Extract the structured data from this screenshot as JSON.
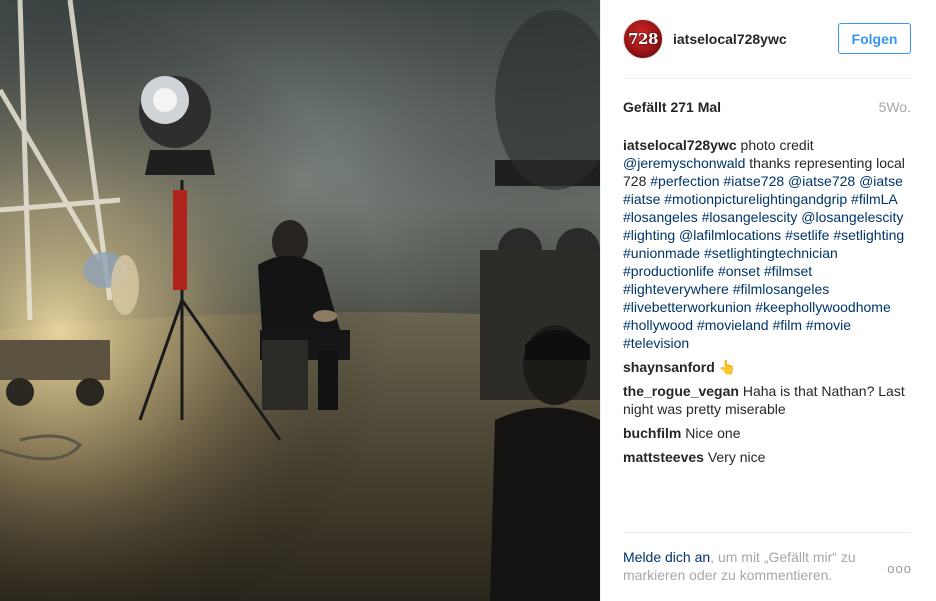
{
  "post": {
    "image_alt": "Film set at night with lighting equipment and a man sitting on a crate"
  },
  "header": {
    "avatar_text": "728",
    "username": "iatselocal728ywc",
    "follow_label": "Folgen"
  },
  "stats": {
    "likes_prefix": "Gefällt ",
    "likes_count": "271",
    "likes_suffix": " Mal",
    "age": "5Wo."
  },
  "caption": {
    "author": "iatselocal728ywc",
    "parts": [
      {
        "t": " photo credit "
      },
      {
        "t": "@jeremyschonwald",
        "link": true
      },
      {
        "t": " thanks representing local 728 "
      },
      {
        "t": "#perfection",
        "link": true
      },
      {
        "t": " "
      },
      {
        "t": "#iatse728",
        "link": true
      },
      {
        "t": " "
      },
      {
        "t": "@iatse728",
        "link": true
      },
      {
        "t": " "
      },
      {
        "t": "@iatse",
        "link": true
      },
      {
        "t": " "
      },
      {
        "t": "#iatse",
        "link": true
      },
      {
        "t": " "
      },
      {
        "t": "#motionpicturelightingandgrip",
        "link": true
      },
      {
        "t": " "
      },
      {
        "t": "#filmLA",
        "link": true
      },
      {
        "t": " "
      },
      {
        "t": "#losangeles",
        "link": true
      },
      {
        "t": " "
      },
      {
        "t": "#losangelescity",
        "link": true
      },
      {
        "t": " "
      },
      {
        "t": "@losangelescity",
        "link": true
      },
      {
        "t": " "
      },
      {
        "t": "#lighting",
        "link": true
      },
      {
        "t": " "
      },
      {
        "t": "@lafilmlocations",
        "link": true
      },
      {
        "t": " "
      },
      {
        "t": "#setlife",
        "link": true
      },
      {
        "t": " "
      },
      {
        "t": "#setlighting",
        "link": true
      },
      {
        "t": " "
      },
      {
        "t": "#unionmade",
        "link": true
      },
      {
        "t": " "
      },
      {
        "t": "#setlightingtechnician",
        "link": true
      },
      {
        "t": " "
      },
      {
        "t": "#productionlife",
        "link": true
      },
      {
        "t": " "
      },
      {
        "t": "#onset",
        "link": true
      },
      {
        "t": " "
      },
      {
        "t": "#filmset",
        "link": true
      },
      {
        "t": " "
      },
      {
        "t": "#lighteverywhere",
        "link": true
      },
      {
        "t": " "
      },
      {
        "t": "#filmlosangeles",
        "link": true
      },
      {
        "t": " "
      },
      {
        "t": "#livebetterworkunion",
        "link": true
      },
      {
        "t": " "
      },
      {
        "t": "#keephollywoodhome",
        "link": true
      },
      {
        "t": " "
      },
      {
        "t": "#hollywood",
        "link": true
      },
      {
        "t": " "
      },
      {
        "t": "#movieland",
        "link": true
      },
      {
        "t": " "
      },
      {
        "t": "#film",
        "link": true
      },
      {
        "t": " "
      },
      {
        "t": "#movie",
        "link": true
      },
      {
        "t": " "
      },
      {
        "t": "#television",
        "link": true
      }
    ]
  },
  "comments": [
    {
      "author": "shaynsanford",
      "text": "👆"
    },
    {
      "author": "the_rogue_vegan",
      "text": "Haha is that Nathan? Last night was pretty miserable"
    },
    {
      "author": "buchfilm",
      "text": "Nice one"
    },
    {
      "author": "mattsteeves",
      "text": "Very nice"
    }
  ],
  "footer": {
    "login_link": "Melde dich an",
    "rest": ", um mit „Gefällt mir“ zu markieren oder zu kommentieren.",
    "more_label": "ooo"
  },
  "colors": {
    "link": "#003569",
    "follow": "#3897f0",
    "muted": "#a5a7aa"
  }
}
